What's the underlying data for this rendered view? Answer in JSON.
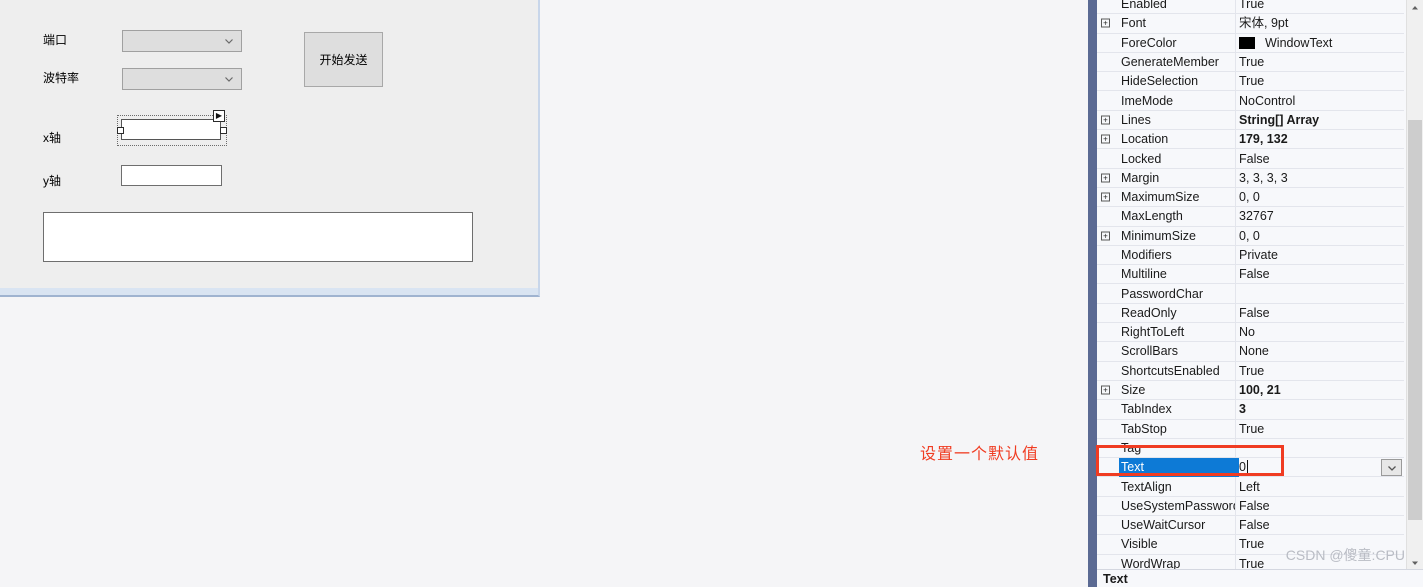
{
  "designer": {
    "labels": [
      {
        "text": "端口"
      },
      {
        "text": "波特率"
      },
      {
        "text": "x轴"
      },
      {
        "text": "y轴"
      }
    ],
    "port_combo": {
      "value": "",
      "placeholder": ""
    },
    "baud_combo": {
      "value": "",
      "placeholder": ""
    },
    "send_button": {
      "label": "开始发送"
    },
    "x_axis_textbox": {
      "value": "",
      "selected": true
    },
    "y_axis_textbox": {
      "value": ""
    },
    "output_textbox": {
      "value": ""
    }
  },
  "annotation": {
    "text": "设置一个默认值",
    "color": "#f03c22"
  },
  "properties_panel": {
    "accent_color": "#0d7ad6",
    "description_title": "Text",
    "rows": [
      {
        "name": "Enabled",
        "value": "True",
        "expander": false,
        "bold": false
      },
      {
        "name": "Font",
        "value": "宋体, 9pt",
        "expander": true,
        "bold": false
      },
      {
        "name": "ForeColor",
        "value": "WindowText",
        "expander": false,
        "bold": false,
        "swatch": "#000000"
      },
      {
        "name": "GenerateMember",
        "value": "True",
        "expander": false,
        "bold": false
      },
      {
        "name": "HideSelection",
        "value": "True",
        "expander": false,
        "bold": false
      },
      {
        "name": "ImeMode",
        "value": "NoControl",
        "expander": false,
        "bold": false
      },
      {
        "name": "Lines",
        "value": "String[] Array",
        "expander": true,
        "bold": true
      },
      {
        "name": "Location",
        "value": "179, 132",
        "expander": true,
        "bold": true
      },
      {
        "name": "Locked",
        "value": "False",
        "expander": false,
        "bold": false
      },
      {
        "name": "Margin",
        "value": "3, 3, 3, 3",
        "expander": true,
        "bold": false
      },
      {
        "name": "MaximumSize",
        "value": "0, 0",
        "expander": true,
        "bold": false
      },
      {
        "name": "MaxLength",
        "value": "32767",
        "expander": false,
        "bold": false
      },
      {
        "name": "MinimumSize",
        "value": "0, 0",
        "expander": true,
        "bold": false
      },
      {
        "name": "Modifiers",
        "value": "Private",
        "expander": false,
        "bold": false
      },
      {
        "name": "Multiline",
        "value": "False",
        "expander": false,
        "bold": false
      },
      {
        "name": "PasswordChar",
        "value": "",
        "expander": false,
        "bold": false
      },
      {
        "name": "ReadOnly",
        "value": "False",
        "expander": false,
        "bold": false
      },
      {
        "name": "RightToLeft",
        "value": "No",
        "expander": false,
        "bold": false
      },
      {
        "name": "ScrollBars",
        "value": "None",
        "expander": false,
        "bold": false
      },
      {
        "name": "ShortcutsEnabled",
        "value": "True",
        "expander": false,
        "bold": false
      },
      {
        "name": "Size",
        "value": "100, 21",
        "expander": true,
        "bold": true
      },
      {
        "name": "TabIndex",
        "value": "3",
        "expander": false,
        "bold": true
      },
      {
        "name": "TabStop",
        "value": "True",
        "expander": false,
        "bold": false
      },
      {
        "name": "Tag",
        "value": "",
        "expander": false,
        "bold": false
      },
      {
        "name": "Text",
        "value": "0",
        "expander": false,
        "bold": false,
        "selected": true,
        "editing": true
      },
      {
        "name": "TextAlign",
        "value": "Left",
        "expander": false,
        "bold": false
      },
      {
        "name": "UseSystemPasswordChar",
        "value": "False",
        "expander": false,
        "bold": false
      },
      {
        "name": "UseWaitCursor",
        "value": "False",
        "expander": false,
        "bold": false
      },
      {
        "name": "Visible",
        "value": "True",
        "expander": false,
        "bold": false
      },
      {
        "name": "WordWrap",
        "value": "True",
        "expander": false,
        "bold": false
      }
    ]
  },
  "watermark": {
    "text": "CSDN @傻童:CPU"
  }
}
